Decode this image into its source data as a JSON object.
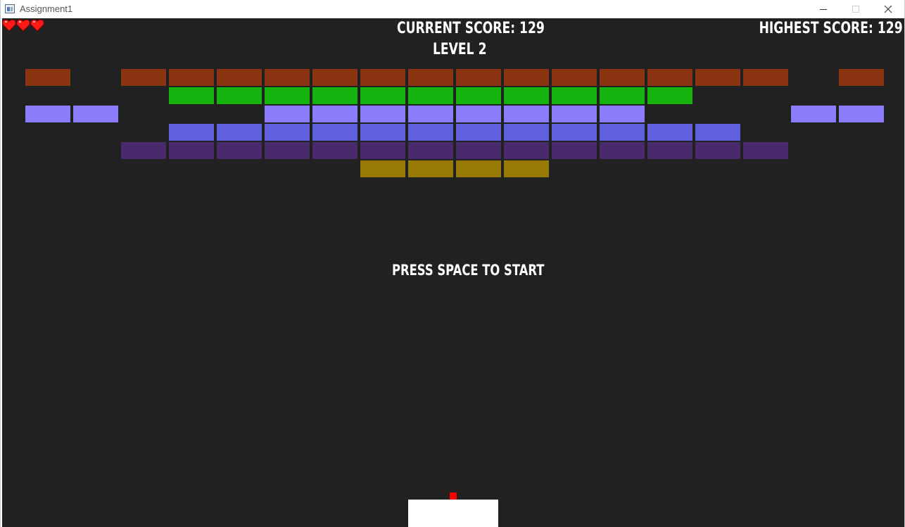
{
  "window": {
    "title": "Assignment1",
    "app_icon": "window-app-icon",
    "controls": [
      {
        "name": "minimize-button",
        "icon": "minimize-icon"
      },
      {
        "name": "maximize-button",
        "icon": "maximize-icon"
      },
      {
        "name": "close-button",
        "icon": "close-icon"
      }
    ]
  },
  "hud": {
    "current_score": "CURRENT SCORE: 129",
    "highest_score": "HIGHEST SCORE: 129",
    "level": "LEVEL 2",
    "prompt": "PRESS SPACE TO START",
    "lives": 3,
    "life_icon": "heart-icon"
  },
  "colors": {
    "background": "#212121",
    "text": "#ffffff",
    "paddle": "#ffffff",
    "ball": "#ff0000",
    "heart": "#ff1a1a",
    "rows": [
      "#8a3412",
      "#16b30f",
      "#8a7cfa",
      "#6160dc",
      "#4a2a6e",
      "#977a05"
    ]
  },
  "bricks": {
    "columns": 18,
    "rows": [
      [
        1,
        0,
        1,
        1,
        1,
        1,
        1,
        1,
        1,
        1,
        1,
        1,
        1,
        1,
        1,
        1,
        0,
        1
      ],
      [
        0,
        0,
        0,
        1,
        1,
        1,
        1,
        1,
        1,
        1,
        1,
        1,
        1,
        1,
        0,
        0,
        0,
        0
      ],
      [
        1,
        1,
        0,
        0,
        0,
        1,
        1,
        1,
        1,
        1,
        1,
        1,
        1,
        0,
        0,
        0,
        1,
        1
      ],
      [
        0,
        0,
        0,
        1,
        1,
        1,
        1,
        1,
        1,
        1,
        1,
        1,
        1,
        1,
        1,
        0,
        0,
        0
      ],
      [
        0,
        0,
        1,
        1,
        1,
        1,
        1,
        1,
        1,
        1,
        1,
        1,
        1,
        1,
        1,
        1,
        0,
        0
      ],
      [
        0,
        0,
        0,
        0,
        0,
        0,
        0,
        1,
        1,
        1,
        1,
        0,
        0,
        0,
        0,
        0,
        0,
        0
      ]
    ]
  }
}
